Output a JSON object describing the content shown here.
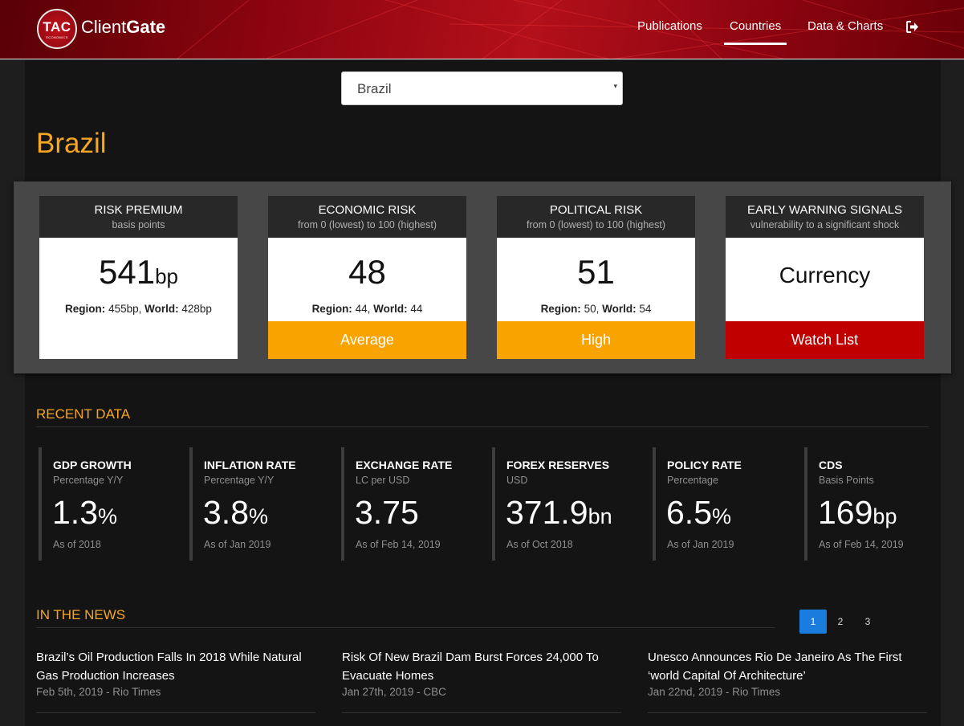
{
  "header": {
    "logo_text": "TAC",
    "logo_subtext": "ECONOMICS",
    "brand_light": "Client",
    "brand_bold": "Gate",
    "nav": [
      {
        "label": "Publications"
      },
      {
        "label": "Countries",
        "active": true
      },
      {
        "label": "Data & Charts"
      }
    ],
    "logout_icon": "sign-out-icon",
    "colors": {
      "header_red": "#b3101a",
      "active_underline": "#ffffff"
    }
  },
  "country_select": {
    "value": "Brazil"
  },
  "country": {
    "name": "Brazil",
    "title_color": "#f5a623"
  },
  "risk_cards": [
    {
      "title": "RISK PREMIUM",
      "subtitle": "basis points",
      "value": "541",
      "unit": "bp",
      "compare": {
        "region_label": "Region:",
        "region_value": "455bp",
        "world_label": "World:",
        "world_value": "428bp"
      },
      "status": "",
      "status_color": ""
    },
    {
      "title": "ECONOMIC RISK",
      "subtitle": "from 0 (lowest) to 100 (highest)",
      "value": "48",
      "unit": "",
      "compare": {
        "region_label": "Region:",
        "region_value": "44",
        "world_label": "World:",
        "world_value": "44"
      },
      "status": "Average",
      "status_color": "#f9a300"
    },
    {
      "title": "POLITICAL RISK",
      "subtitle": "from 0 (lowest) to 100 (highest)",
      "value": "51",
      "unit": "",
      "compare": {
        "region_label": "Region:",
        "region_value": "50",
        "world_label": "World:",
        "world_value": "54"
      },
      "status": "High",
      "status_color": "#f9a300"
    },
    {
      "title": "EARLY WARNING SIGNALS",
      "subtitle": "vulnerability to a significant shock",
      "value": "Currency",
      "unit": "",
      "status": "Watch List",
      "status_color": "#c00000"
    }
  ],
  "recent_data": {
    "heading": "RECENT DATA",
    "items": [
      {
        "title": "GDP GROWTH",
        "subtitle": "Percentage Y/Y",
        "value": "1.3",
        "unit": "%",
        "date": "As of 2018"
      },
      {
        "title": "INFLATION RATE",
        "subtitle": "Percentage Y/Y",
        "value": "3.8",
        "unit": "%",
        "date": "As of Jan 2019"
      },
      {
        "title": "EXCHANGE RATE",
        "subtitle": "LC per USD",
        "value": "3.75",
        "unit": "",
        "date": "As of Feb 14, 2019"
      },
      {
        "title": "FOREX RESERVES",
        "subtitle": "USD",
        "value": "371.9",
        "unit": "bn",
        "date": "As of Oct 2018"
      },
      {
        "title": "POLICY RATE",
        "subtitle": "Percentage",
        "value": "6.5",
        "unit": "%",
        "date": "As of Jan 2019"
      },
      {
        "title": "CDS",
        "subtitle": "Basis Points",
        "value": "169",
        "unit": "bp",
        "date": "As of Feb 14, 2019"
      }
    ]
  },
  "news": {
    "heading": "IN THE NEWS",
    "pages": [
      {
        "label": "1",
        "active": true
      },
      {
        "label": "2",
        "active": false
      },
      {
        "label": "3",
        "active": false
      }
    ],
    "items": [
      {
        "title": "Brazil’s Oil Production Falls In 2018 While Natural Gas Production Increases",
        "meta": "Feb 5th, 2019 - Rio Times"
      },
      {
        "title": "Risk Of New Brazil Dam Burst Forces 24,000 To Evacuate Homes",
        "meta": "Jan 27th, 2019 - CBC"
      },
      {
        "title": "Unesco Announces Rio De Janeiro As The First ‘world Capital Of Architecture’",
        "meta": "Jan 22nd, 2019 - Rio Times"
      }
    ]
  }
}
